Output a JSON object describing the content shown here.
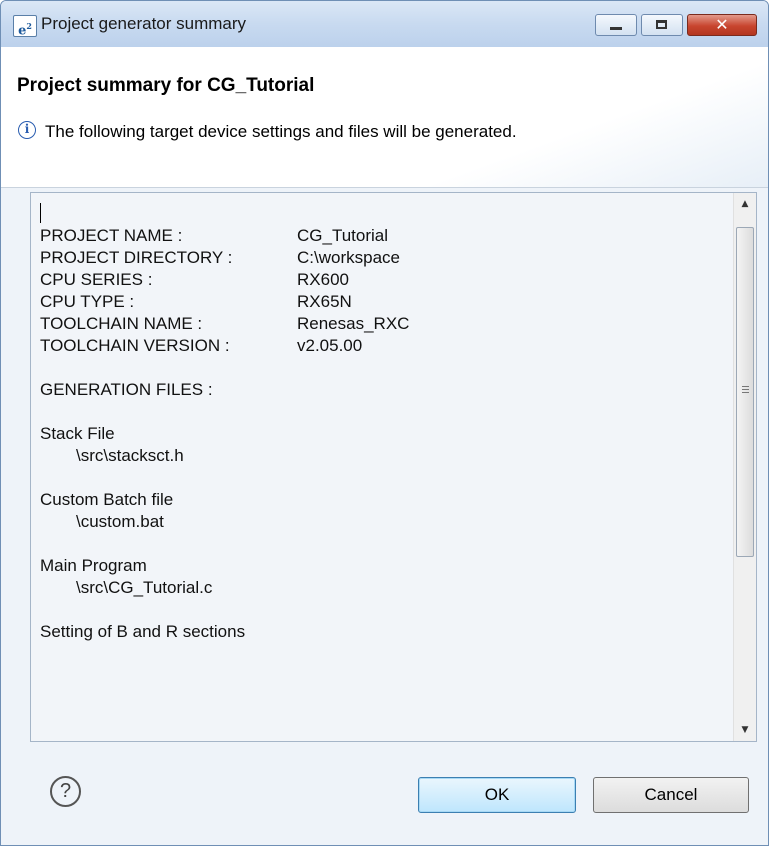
{
  "window": {
    "title": "Project generator summary",
    "icon_label": "e²",
    "controls": {
      "minimize": "minimize",
      "maximize": "maximize",
      "close": "✕"
    }
  },
  "header": {
    "title": "Project summary for CG_Tutorial",
    "info_icon": "info-icon",
    "message": "The following target device settings and files will be generated."
  },
  "summary": {
    "settings": [
      {
        "key": "PROJECT NAME :",
        "value": "CG_Tutorial"
      },
      {
        "key": "PROJECT DIRECTORY :",
        "value": "C:\\workspace"
      },
      {
        "key": "CPU SERIES :",
        "value": "RX600"
      },
      {
        "key": "CPU TYPE :",
        "value": "RX65N"
      },
      {
        "key": "TOOLCHAIN NAME :",
        "value": "Renesas_RXC"
      },
      {
        "key": "TOOLCHAIN VERSION :",
        "value": "v2.05.00"
      }
    ],
    "generation_label": "GENERATION FILES :",
    "files": [
      {
        "name": "Stack File",
        "path": "\\src\\stacksct.h"
      },
      {
        "name": "Custom Batch file",
        "path": "\\custom.bat"
      },
      {
        "name": "Main Program",
        "path": "\\src\\CG_Tutorial.c"
      }
    ],
    "last_line": "Setting of B and R sections"
  },
  "footer": {
    "help_icon": "help-icon",
    "help_glyph": "?",
    "ok_label": "OK",
    "cancel_label": "Cancel"
  }
}
